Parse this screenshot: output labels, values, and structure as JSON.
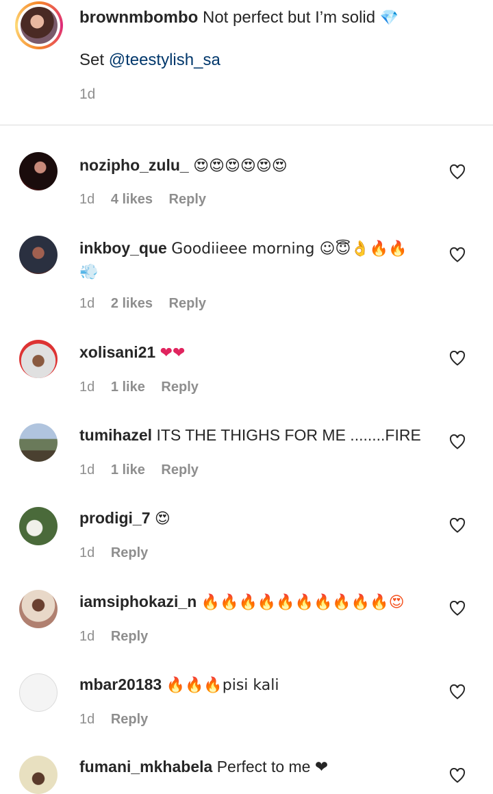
{
  "post": {
    "username": "brownmbombo",
    "caption": "Not perfect but I’m solid",
    "caption_emoji": "💎",
    "set_prefix": "Set",
    "mention": "@teestylish_sa",
    "time": "1d"
  },
  "comments": [
    {
      "username": "nozipho_zulu_",
      "text": "😍😍😍😍😍😍",
      "time": "1d",
      "likes": "4 likes",
      "reply": "Reply"
    },
    {
      "username": "inkboy_que",
      "text": "Goodiieee morning ☺😇👌🔥🔥",
      "text2": "💨",
      "time": "1d",
      "likes": "2 likes",
      "reply": "Reply"
    },
    {
      "username": "xolisani21",
      "text": "❤❤",
      "time": "1d",
      "likes": "1 like",
      "reply": "Reply"
    },
    {
      "username": "tumihazel",
      "text": "ITS THE THIGHS FOR ME ........FIRE",
      "time": "1d",
      "likes": "1 like",
      "reply": "Reply"
    },
    {
      "username": "prodigi_7",
      "text": "😍",
      "time": "1d",
      "likes": "",
      "reply": "Reply"
    },
    {
      "username": "iamsiphokazi_n",
      "text": "🔥🔥🔥🔥🔥🔥🔥🔥🔥🔥😍",
      "time": "1d",
      "likes": "",
      "reply": "Reply"
    },
    {
      "username": "mbar20183",
      "text": "🔥🔥🔥pisi kali",
      "time": "1d",
      "likes": "",
      "reply": "Reply"
    },
    {
      "username": "fumani_mkhabela",
      "text": "Perfect to me ❤",
      "time": "",
      "likes": "",
      "reply": ""
    }
  ],
  "colors": {
    "text": "#262626",
    "muted": "#8e8e8e",
    "link": "#00376b",
    "divider": "#dbdbdb"
  },
  "icons": {
    "like": "heart-outline-icon"
  }
}
